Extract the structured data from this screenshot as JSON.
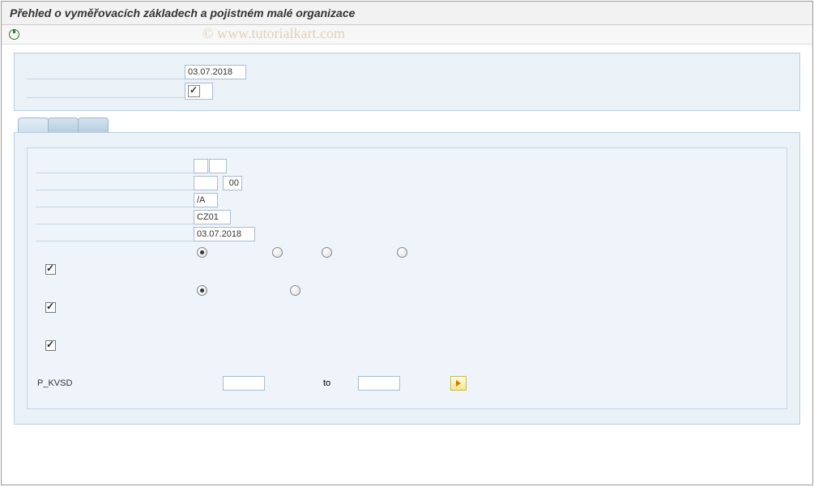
{
  "header": {
    "title": "Přehled o vyměřovacích základech a pojistném malé organizace"
  },
  "watermark": "© www.tutorialkart.com",
  "top_panel": {
    "date": "03.07.2018",
    "checkbox_checked": true
  },
  "main_panel": {
    "field1a": "",
    "field1b": "",
    "field2a": "",
    "field2b": "00",
    "field3": "/A",
    "field4": "CZ01",
    "field5_date": "03.07.2018",
    "radio_row1_selected": 0,
    "radio_row2_selected": 0,
    "checkbox1": true,
    "checkbox2": true,
    "checkbox3": true,
    "pkvsd_label": "P_KVSD",
    "to_label": "to",
    "pkvsd_from": "",
    "pkvsd_to": ""
  }
}
